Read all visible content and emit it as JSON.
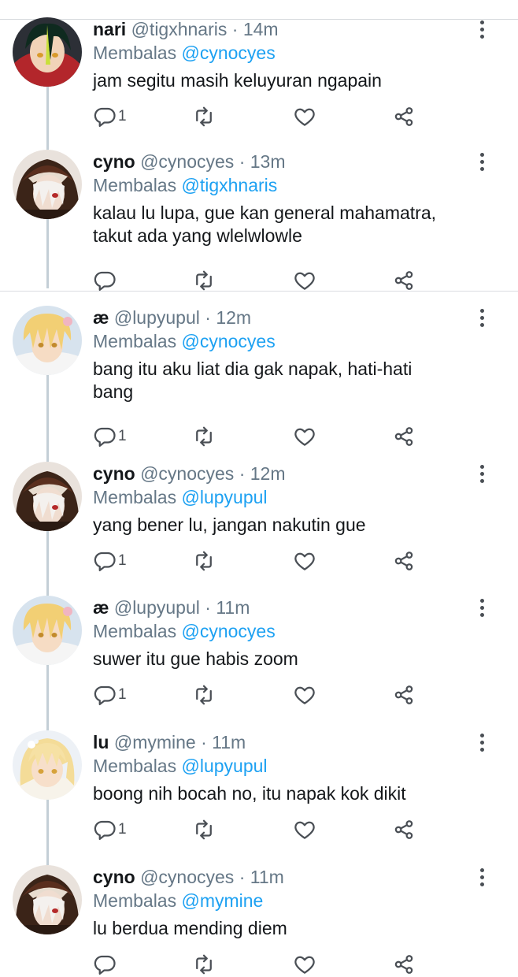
{
  "prefix_reply": "Membalas ",
  "tweets": [
    {
      "name": "nari",
      "handle": "@tigxhnaris",
      "time": "· 14m",
      "reply_to": "@cynocyes",
      "text": "jam segitu masih keluyuran ngapain",
      "reply_count": "1",
      "avatar": "dark-green-hair-character"
    },
    {
      "name": "cyno",
      "handle": "@cynocyes",
      "time": "· 13m",
      "reply_to": "@tigxhnaris",
      "text": "kalau lu lupa, gue kan general mahamatra,\ntakut ada yang wlelwlowle",
      "reply_count": "",
      "avatar": "white-hair-hooded-character"
    },
    {
      "name": "æ",
      "handle": "@lupyupul",
      "time": "· 12m",
      "reply_to": "@cynocyes",
      "text": "bang itu aku liat dia gak napak, hati-hati\nbang",
      "reply_count": "1",
      "avatar": "blonde-boy-character"
    },
    {
      "name": "cyno",
      "handle": "@cynocyes",
      "time": "· 12m",
      "reply_to": "@lupyupul",
      "text": "yang bener lu, jangan nakutin gue",
      "reply_count": "1",
      "avatar": "white-hair-hooded-character"
    },
    {
      "name": "æ",
      "handle": "@lupyupul",
      "time": "· 11m",
      "reply_to": "@cynocyes",
      "text": "suwer itu gue habis zoom",
      "reply_count": "1",
      "avatar": "blonde-boy-character"
    },
    {
      "name": "lu",
      "handle": "@mymine",
      "time": "· 11m",
      "reply_to": "@lupyupul",
      "text": "boong nih bocah no, itu napak kok dikit",
      "reply_count": "1",
      "avatar": "blonde-girl-character"
    },
    {
      "name": "cyno",
      "handle": "@cynocyes",
      "time": "· 11m",
      "reply_to": "@mymine",
      "text": "lu berdua mending diem",
      "reply_count": "",
      "avatar": "white-hair-hooded-character"
    }
  ],
  "colors": {
    "mention": "#1da1f2",
    "muted": "#657786",
    "thread_line": "#c4cfd6"
  },
  "icons": [
    "reply-icon",
    "retweet-icon",
    "like-icon",
    "share-icon",
    "more-options-icon"
  ]
}
